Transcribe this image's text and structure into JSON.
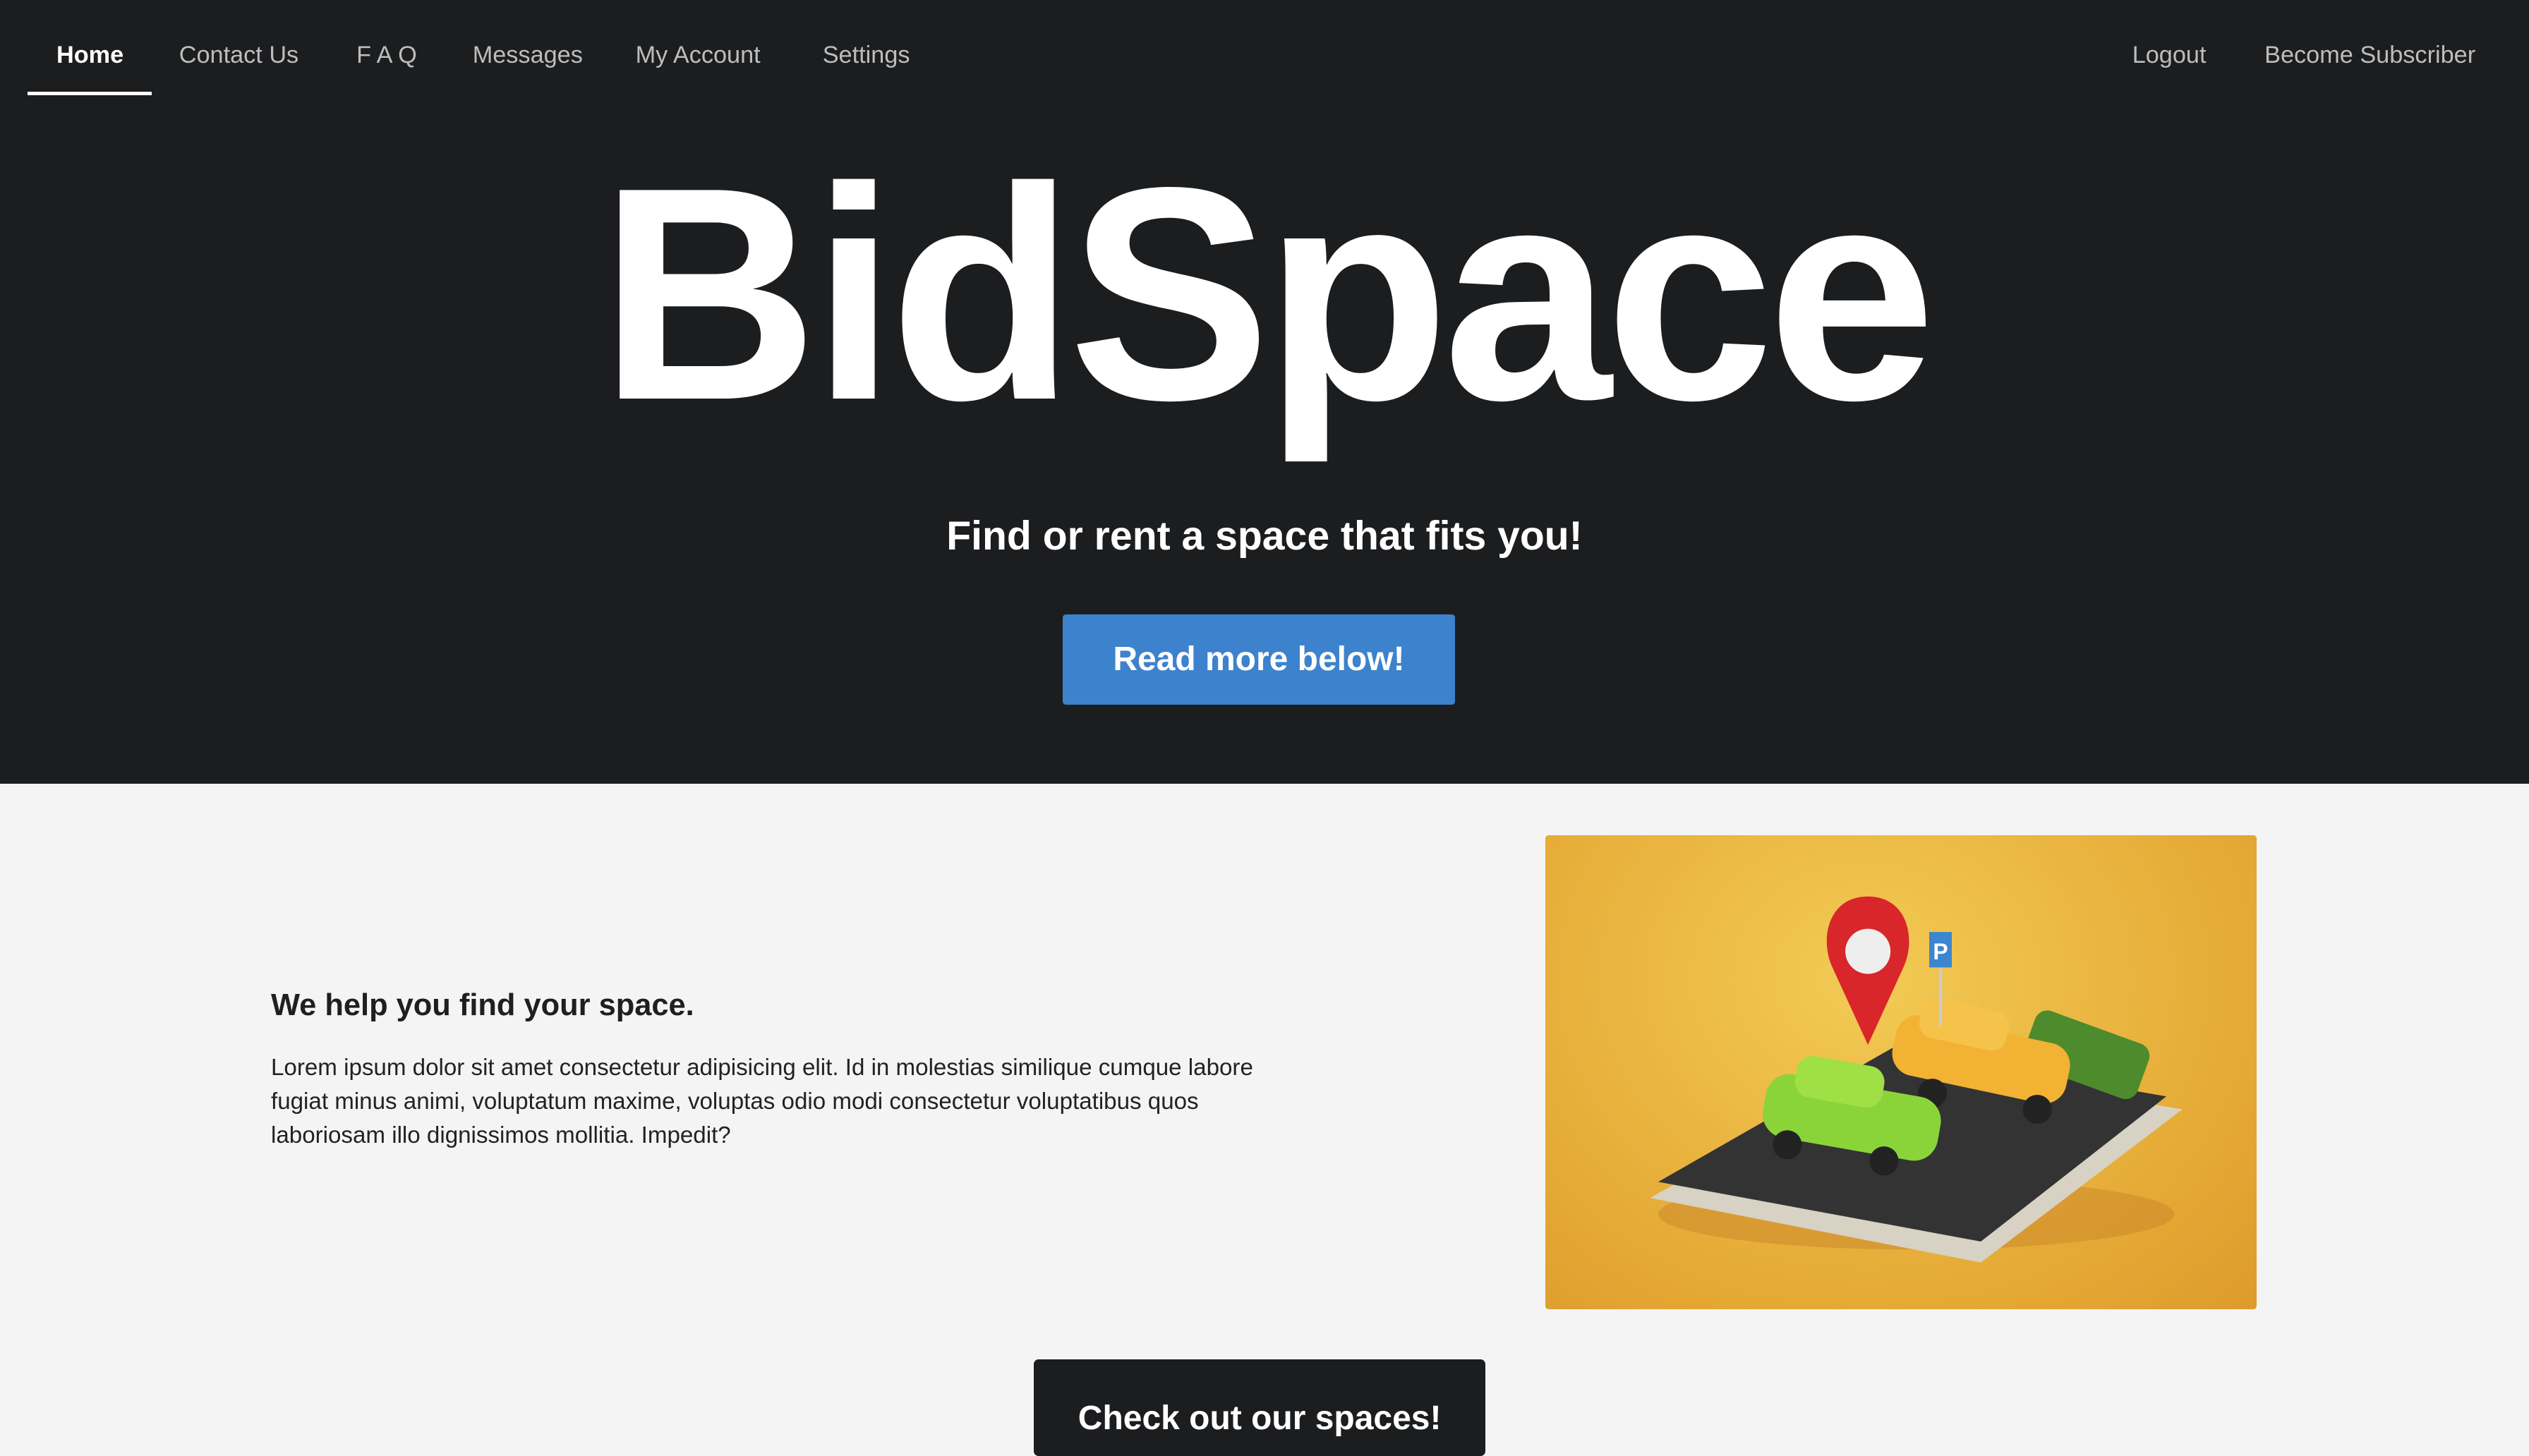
{
  "nav": {
    "left": [
      "Home",
      "Contact Us",
      "F A Q",
      "Messages",
      "My Account",
      "Settings"
    ],
    "right": [
      "Logout",
      "Become Subscriber"
    ]
  },
  "hero": {
    "title": "BidSpace",
    "subtitle": "Find or rent a space that fits you!",
    "button": "Read more below!"
  },
  "about": {
    "heading": "We help you find your space.",
    "body": "Lorem ipsum dolor sit amet consectetur adipisicing elit. Id in molestias similique cumque labore fugiat minus animi, voluptatum maxime, voluptas odio modi consectetur voluptatibus quos laboriosam illo dignissimos mollitia. Impedit?",
    "image_sign": "P"
  },
  "cta": {
    "button": "Check out our spaces!"
  }
}
